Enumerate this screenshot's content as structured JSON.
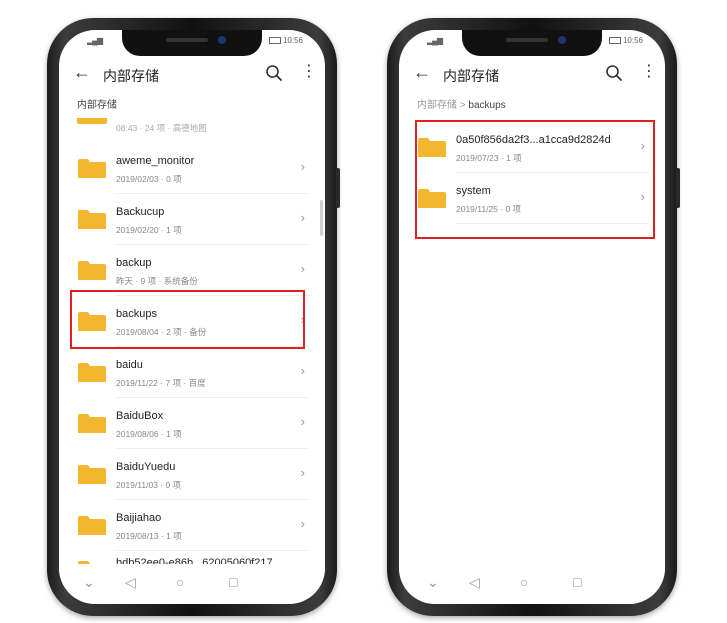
{
  "status": {
    "signal": "▂▄▆",
    "time": "10:56"
  },
  "left_phone": {
    "toolbar": {
      "title": "内部存储"
    },
    "breadcrumb": "内部存储",
    "partial_top_meta": "08:43 · 24 项 · 高德地图",
    "items": [
      {
        "name": "aweme_monitor",
        "meta": "2019/02/03 · 0 项"
      },
      {
        "name": "Backucup",
        "meta": "2019/02/20 · 1 项"
      },
      {
        "name": "backup",
        "meta": "昨天 · 9 项 · 系统备份"
      },
      {
        "name": "backups",
        "meta": "2019/08/04 · 2 项 · 备份"
      },
      {
        "name": "baidu",
        "meta": "2019/11/22 · 7 项 · 百度"
      },
      {
        "name": "BaiduBox",
        "meta": "2019/08/06 · 1 项"
      },
      {
        "name": "BaiduYuedu",
        "meta": "2019/11/03 · 0 项"
      },
      {
        "name": "Baijiahao",
        "meta": "2019/08/13 · 1 项"
      }
    ],
    "partial_bottom_name": "bdb52ee0-e86b...62005060f217"
  },
  "right_phone": {
    "toolbar": {
      "title": "内部存储"
    },
    "breadcrumb_root": "内部存储",
    "breadcrumb_sep": ">",
    "breadcrumb_current": "backups",
    "items": [
      {
        "name": "0a50f856da2f3...a1cca9d2824d",
        "meta": "2019/07/23 · 1 项"
      },
      {
        "name": "system",
        "meta": "2019/11/25 · 0 项"
      }
    ]
  },
  "icons": {
    "back": "arrow-left",
    "search": "magnifier",
    "more": "vertical-ellipsis",
    "folder": "folder",
    "chevron": "chevron-right"
  },
  "colors": {
    "folder": "#f3b72f",
    "highlight": "#e02020"
  }
}
